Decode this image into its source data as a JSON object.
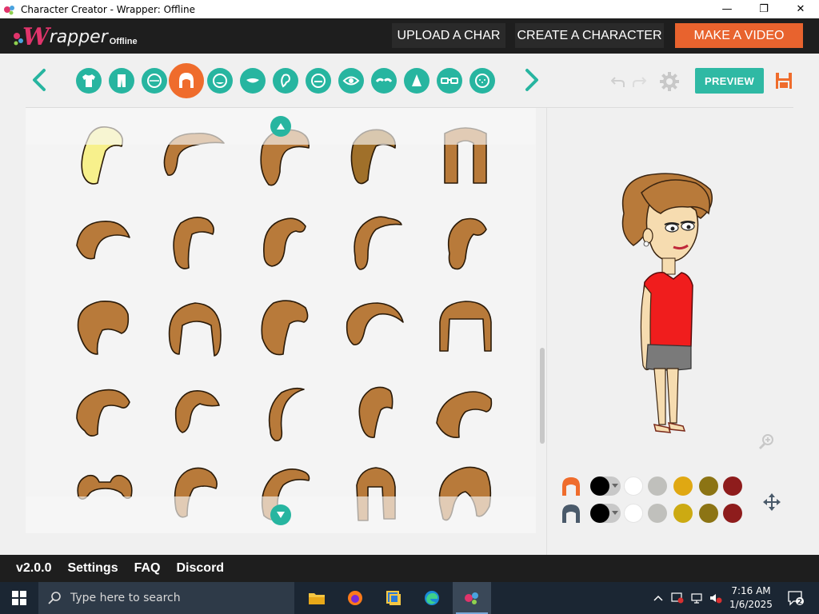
{
  "window": {
    "title": "Character Creator - Wrapper: Offline",
    "minimize_glyph": "—",
    "maximize_glyph": "❐",
    "close_glyph": "✕"
  },
  "header": {
    "logo_w": "W",
    "logo_rest": "rapper",
    "logo_sub": "Offline",
    "upload_label": "UPLOAD A CHAR",
    "create_label": "CREATE A CHARACTER",
    "video_label": "MAKE A VIDEO"
  },
  "toolbar": {
    "categories": [
      {
        "icon": "shirt-icon",
        "active": false
      },
      {
        "icon": "pants-icon",
        "active": false
      },
      {
        "icon": "face-shape-icon",
        "active": false
      },
      {
        "icon": "hair-icon",
        "active": true
      },
      {
        "icon": "head-outline-icon",
        "active": false
      },
      {
        "icon": "mouth-icon",
        "active": false
      },
      {
        "icon": "ear-icon",
        "active": false
      },
      {
        "icon": "facial-hair-icon",
        "active": false
      },
      {
        "icon": "eye-icon",
        "active": false
      },
      {
        "icon": "eyebrow-icon",
        "active": false
      },
      {
        "icon": "nose-icon",
        "active": false
      },
      {
        "icon": "glasses-icon",
        "active": false
      },
      {
        "icon": "freckles-icon",
        "active": false
      }
    ],
    "preview_label": "PREVIEW"
  },
  "hair_grid": {
    "rows": 5,
    "cols": 5,
    "items": [
      {
        "color": "#f7f08c",
        "style": "curly-pony"
      },
      {
        "color": "#b87a3a",
        "style": "swoop-side"
      },
      {
        "color": "#b87a3a",
        "style": "bob-tail"
      },
      {
        "color": "#a0702a",
        "style": "side-part"
      },
      {
        "color": "#b87a3a",
        "style": "long-straight"
      },
      {
        "color": "#b87a3a",
        "style": "short-swoop"
      },
      {
        "color": "#b87a3a",
        "style": "pixie"
      },
      {
        "color": "#b87a3a",
        "style": "side-sweep"
      },
      {
        "color": "#b87a3a",
        "style": "spiky"
      },
      {
        "color": "#b87a3a",
        "style": "bun-side"
      },
      {
        "color": "#b87a3a",
        "style": "bouffant"
      },
      {
        "color": "#b87a3a",
        "style": "round-bob"
      },
      {
        "color": "#b87a3a",
        "style": "wavy"
      },
      {
        "color": "#b87a3a",
        "style": "swept-fringe"
      },
      {
        "color": "#b87a3a",
        "style": "bangs-bob"
      },
      {
        "color": "#b87a3a",
        "style": "flip"
      },
      {
        "color": "#b87a3a",
        "style": "ponytail"
      },
      {
        "color": "#b87a3a",
        "style": "swoop-thin"
      },
      {
        "color": "#b87a3a",
        "style": "high-pony"
      },
      {
        "color": "#b87a3a",
        "style": "side-wave"
      },
      {
        "color": "#b87a3a",
        "style": "pigtails"
      },
      {
        "color": "#b87a3a",
        "style": "messy-bun"
      },
      {
        "color": "#b87a3a",
        "style": "curl-end"
      },
      {
        "color": "#b87a3a",
        "style": "straight-fringe"
      },
      {
        "color": "#b87a3a",
        "style": "top-bun"
      }
    ]
  },
  "colors": {
    "row1": {
      "part_icon": "hair-color-icon",
      "selected": "#000000",
      "swatches": [
        "#ffffff",
        "#c0c0bc",
        "#e0a812",
        "#8c7414",
        "#8e1c1c"
      ]
    },
    "row2": {
      "part_icon": "hair-accent-icon",
      "selected": "#000000",
      "swatches": [
        "#ffffff",
        "#c0c0bc",
        "#ccaa12",
        "#8c7414",
        "#8e1c1c"
      ]
    }
  },
  "footer": {
    "version": "v2.0.0",
    "settings": "Settings",
    "faq": "FAQ",
    "discord": "Discord"
  },
  "taskbar": {
    "search_placeholder": "Type here to search",
    "time": "7:16 AM",
    "date": "1/6/2025",
    "notification_count": "2"
  }
}
